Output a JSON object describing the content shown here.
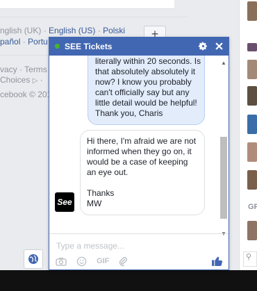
{
  "languages": {
    "row1": [
      "nglish (UK)",
      "English (US)",
      "Polski"
    ],
    "row2": [
      "pañol",
      "Portu"
    ],
    "separator": " · "
  },
  "footer": {
    "row1": [
      "vacy",
      "Terms"
    ],
    "row2": "Choices",
    "copyright": "cebook © 201"
  },
  "add_button": "+",
  "right_sidebar": {
    "group_label": "GF"
  },
  "chat": {
    "title": "SEE Tickets",
    "status": "online",
    "messages": [
      {
        "from": "user",
        "lines": [
          "literally within 20 seconds. Is",
          "that absolutely absolutely it",
          "now? I know you probably",
          "can't officially say but any",
          "little detail would be helpful!",
          "Thank you, Charis"
        ]
      },
      {
        "from": "page",
        "lines": [
          "Hi there, I'm afraid we are not",
          "informed when they go on, it",
          "would be a case of keeping",
          "an eye out.",
          "",
          "Thanks",
          "MW"
        ]
      }
    ],
    "page_logo_text": "See",
    "composer": {
      "placeholder": "Type a message...",
      "gif_label": "GIF"
    },
    "colors": {
      "header": "#4267b2",
      "online": "#42b72a",
      "user_bubble": "#e2ecfb",
      "like": "#4267b2"
    }
  }
}
